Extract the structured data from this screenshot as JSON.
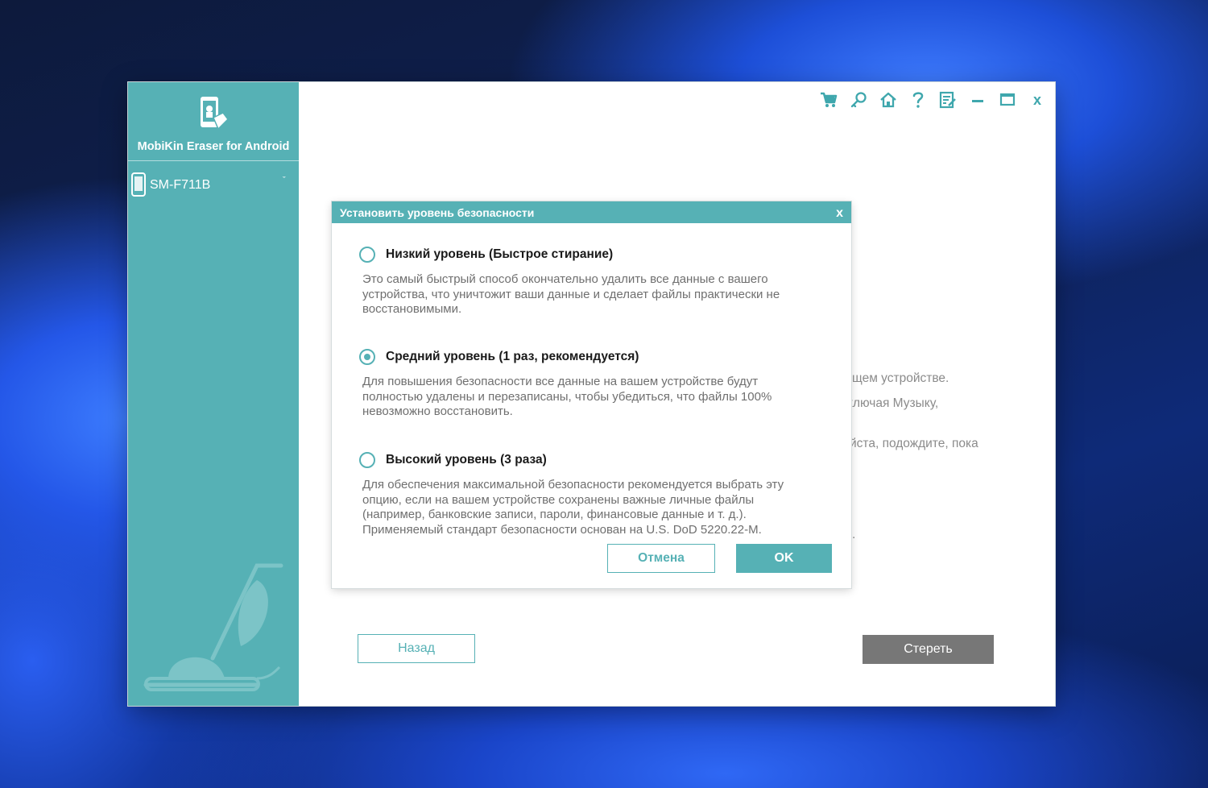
{
  "app": {
    "title": "MobiKin Eraser for Android",
    "device_name": "SM-F711B",
    "device_chevron": "ˇ"
  },
  "toolbar": {
    "icons": [
      "cart-icon",
      "key-icon",
      "home-icon",
      "help-icon",
      "feedback-icon",
      "minimize-icon",
      "maximize-icon",
      "close-icon"
    ],
    "close_label": "x"
  },
  "background_text": {
    "line1": "щем устройстве.",
    "line2": "ключая Музыку,",
    "line3": "йста, подождите, пока",
    "line4": "."
  },
  "buttons": {
    "back": "Назад",
    "erase": "Стереть"
  },
  "dialog": {
    "title": "Установить уровень безопасности",
    "close_label": "x",
    "selected_option": "medium",
    "options": [
      {
        "id": "low",
        "label": "Низкий уровень (Быстрое стирание)",
        "description": "Это самый быстрый способ окончательно удалить все данные с вашего устройства, что уничтожит ваши данные и сделает файлы практически не восстановимыми."
      },
      {
        "id": "medium",
        "label": "Средний уровень (1 раз, рекомендуется)",
        "description": "Для повышения безопасности все данные на вашем устройстве будут полностью удалены и перезаписаны, чтобы убедиться, что файлы 100% невозможно восстановить."
      },
      {
        "id": "high",
        "label": "Высокий уровень (3 раза)",
        "description": "Для обеспечения максимальной безопасности рекомендуется выбрать эту опцию, если на вашем устройстве сохранены важные личные файлы (например, банковские записи, пароли, финансовые данные и т. д.). Применяемый стандарт безопасности основан на U.S. DoD 5220.22-M."
      }
    ],
    "cancel_label": "Отмена",
    "ok_label": "OK"
  },
  "colors": {
    "accent": "#56b1b5",
    "erase_button": "#777777",
    "description_text": "#6f6f6f"
  }
}
